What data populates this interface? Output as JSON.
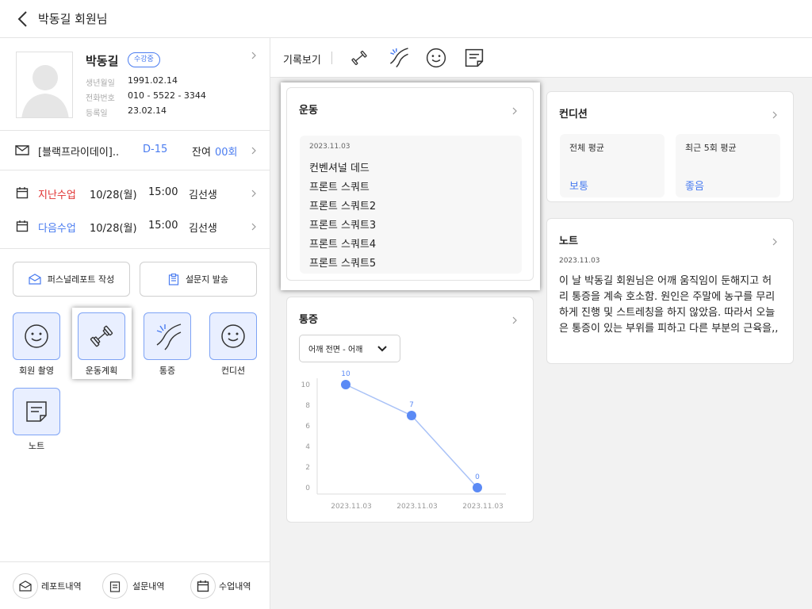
{
  "header": {
    "title": "박동길 회원님"
  },
  "profile": {
    "name": "박동길",
    "status_badge": "수강중",
    "birth_label": "생년월일",
    "birth": "1991.02.14",
    "phone_label": "전화번호",
    "phone": "010 - 5522 - 3344",
    "reg_label": "등록일",
    "reg": "23.02.14"
  },
  "membership": {
    "name": "[블랙프라이데이]..",
    "dday": "D-15",
    "remain_label": "잔여",
    "remain": "00회"
  },
  "lessons": [
    {
      "label": "지난수업",
      "date": "10/28(월)",
      "time": "15:00",
      "teacher": "김선생",
      "label_color": "#e03131"
    },
    {
      "label": "다음수업",
      "date": "10/28(월)",
      "time": "15:00",
      "teacher": "김선생",
      "label_color": "#4a7cf0"
    }
  ],
  "action_buttons": {
    "report": "퍼스널레포트 작성",
    "survey": "설문지 발송"
  },
  "tiles": [
    {
      "label": "회원 촬영",
      "icon": "smile-icon"
    },
    {
      "label": "운동계획",
      "icon": "dumbbell-icon"
    },
    {
      "label": "통증",
      "icon": "pain-icon"
    },
    {
      "label": "컨디션",
      "icon": "smile-icon"
    },
    {
      "label": "노트",
      "icon": "note-icon"
    }
  ],
  "bottom_nav": {
    "report": "레포트내역",
    "survey": "설문내역",
    "lesson": "수업내역"
  },
  "tabbar": {
    "label": "기록보기",
    "icons": [
      "dumbbell-icon",
      "pain-icon",
      "smile-icon",
      "note-icon"
    ]
  },
  "exercise_card": {
    "title": "운동",
    "date": "2023.11.03",
    "items": [
      "컨벤셔널 데드",
      "프론트 스쿼트",
      "프론트 스쿼트2",
      "프론트 스쿼트3",
      "프론트 스쿼트4",
      "프론트 스쿼트5"
    ]
  },
  "condition_card": {
    "title": "컨디션",
    "overall_label": "전체 평균",
    "overall_value": "보통",
    "recent_label": "최근 5회 평균",
    "recent_value": "좋음"
  },
  "note_card": {
    "title": "노트",
    "date": "2023.11.03",
    "text": "이 날 박동길 회원님은 어깨 움직임이 둔해지고 허리 통증을 계속 호소함. 원인은 주말에 농구를 무리하게 진행 및 스트레칭을 하지 않았음. 따라서 오늘은 통증이 있는 부위를 피하고 다른 부분의 근육을,,"
  },
  "pain_card": {
    "title": "통증",
    "dropdown_value": "어깨 전면 - 어깨"
  },
  "chart_data": {
    "type": "line",
    "categories": [
      "2023.11.03",
      "2023.11.03",
      "2023.11.03"
    ],
    "values": [
      10,
      7,
      0
    ],
    "ylim": [
      0,
      10
    ],
    "yticks": [
      0,
      2,
      4,
      6,
      8,
      10
    ],
    "grid": false,
    "line_color": "#a9c2f7",
    "point_color": "#5b8af5",
    "label_color": "#5b8af5"
  },
  "colors": {
    "accent": "#4a7cf0",
    "alert": "#e03131",
    "tile_bg": "#e9efff",
    "tile_border": "#7ea3f5"
  }
}
